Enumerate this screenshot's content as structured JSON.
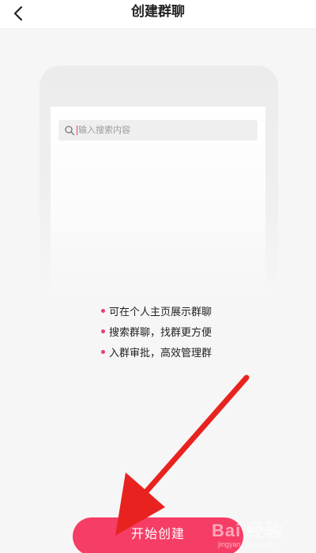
{
  "header": {
    "title": "创建群聊",
    "back_icon": "chevron-left-icon"
  },
  "illustration": {
    "search_placeholder": "输入搜索内容",
    "search_icon": "search-icon"
  },
  "features": [
    {
      "text": "可在个人主页展示群聊"
    },
    {
      "text": "搜索群聊，找群更方便"
    },
    {
      "text": "入群审批，高效管理群"
    }
  ],
  "start_button": {
    "label": "开始创建"
  },
  "watermark": {
    "main": "Bai 经验",
    "sub": "jingyan.baidu.com"
  },
  "colors": {
    "accent": "#f63d66",
    "bullet": "#e8416b",
    "annotation_arrow": "#e8231f"
  }
}
